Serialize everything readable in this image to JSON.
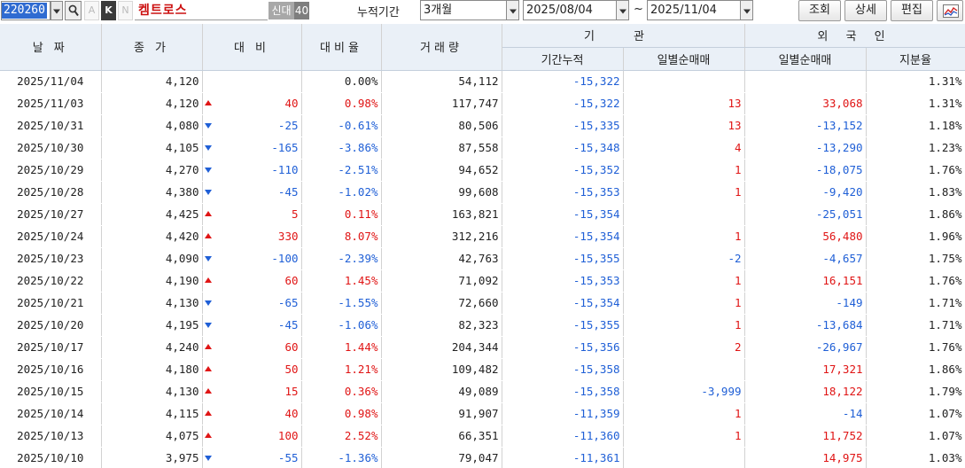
{
  "toolbar": {
    "stock_code": "220260",
    "btn_a": "A",
    "btn_k": "K",
    "btn_n": "N",
    "stock_name": "켐트로스",
    "badge_credit": "신대",
    "badge_margin": "40",
    "period_label": "누적기간",
    "period_value": "3개월",
    "start_date": "2025/08/04",
    "tilde": "~",
    "end_date": "2025/11/04",
    "btn_query": "조회",
    "btn_detail": "상세",
    "btn_edit": "편집"
  },
  "headers": {
    "date": "날 짜",
    "close": "종 가",
    "change": "대 비",
    "change_rate": "대비율",
    "volume": "거래량",
    "institution": "기 관",
    "inst_cum": "기간누적",
    "inst_daily": "일별순매매",
    "foreign": "외 국 인",
    "frn_daily": "일별순매매",
    "frn_ratio": "지분율"
  },
  "rows": [
    {
      "date": "2025/11/04",
      "close": "4,120",
      "dir": "flat",
      "change": "",
      "rate": "0.00%",
      "volume": "54,112",
      "inst_cum": "-15,322",
      "inst_daily": "",
      "frn_daily": "",
      "frn_ratio": "1.31%"
    },
    {
      "date": "2025/11/03",
      "close": "4,120",
      "dir": "up",
      "change": "40",
      "rate": "0.98%",
      "volume": "117,747",
      "inst_cum": "-15,322",
      "inst_daily": "13",
      "frn_daily": "33,068",
      "frn_ratio": "1.31%"
    },
    {
      "date": "2025/10/31",
      "close": "4,080",
      "dir": "down",
      "change": "-25",
      "rate": "-0.61%",
      "volume": "80,506",
      "inst_cum": "-15,335",
      "inst_daily": "13",
      "frn_daily": "-13,152",
      "frn_ratio": "1.18%"
    },
    {
      "date": "2025/10/30",
      "close": "4,105",
      "dir": "down",
      "change": "-165",
      "rate": "-3.86%",
      "volume": "87,558",
      "inst_cum": "-15,348",
      "inst_daily": "4",
      "frn_daily": "-13,290",
      "frn_ratio": "1.23%"
    },
    {
      "date": "2025/10/29",
      "close": "4,270",
      "dir": "down",
      "change": "-110",
      "rate": "-2.51%",
      "volume": "94,652",
      "inst_cum": "-15,352",
      "inst_daily": "1",
      "frn_daily": "-18,075",
      "frn_ratio": "1.76%"
    },
    {
      "date": "2025/10/28",
      "close": "4,380",
      "dir": "down",
      "change": "-45",
      "rate": "-1.02%",
      "volume": "99,608",
      "inst_cum": "-15,353",
      "inst_daily": "1",
      "frn_daily": "-9,420",
      "frn_ratio": "1.83%"
    },
    {
      "date": "2025/10/27",
      "close": "4,425",
      "dir": "up",
      "change": "5",
      "rate": "0.11%",
      "volume": "163,821",
      "inst_cum": "-15,354",
      "inst_daily": "",
      "frn_daily": "-25,051",
      "frn_ratio": "1.86%"
    },
    {
      "date": "2025/10/24",
      "close": "4,420",
      "dir": "up",
      "change": "330",
      "rate": "8.07%",
      "volume": "312,216",
      "inst_cum": "-15,354",
      "inst_daily": "1",
      "frn_daily": "56,480",
      "frn_ratio": "1.96%"
    },
    {
      "date": "2025/10/23",
      "close": "4,090",
      "dir": "down",
      "change": "-100",
      "rate": "-2.39%",
      "volume": "42,763",
      "inst_cum": "-15,355",
      "inst_daily": "-2",
      "frn_daily": "-4,657",
      "frn_ratio": "1.75%"
    },
    {
      "date": "2025/10/22",
      "close": "4,190",
      "dir": "up",
      "change": "60",
      "rate": "1.45%",
      "volume": "71,092",
      "inst_cum": "-15,353",
      "inst_daily": "1",
      "frn_daily": "16,151",
      "frn_ratio": "1.76%"
    },
    {
      "date": "2025/10/21",
      "close": "4,130",
      "dir": "down",
      "change": "-65",
      "rate": "-1.55%",
      "volume": "72,660",
      "inst_cum": "-15,354",
      "inst_daily": "1",
      "frn_daily": "-149",
      "frn_ratio": "1.71%"
    },
    {
      "date": "2025/10/20",
      "close": "4,195",
      "dir": "down",
      "change": "-45",
      "rate": "-1.06%",
      "volume": "82,323",
      "inst_cum": "-15,355",
      "inst_daily": "1",
      "frn_daily": "-13,684",
      "frn_ratio": "1.71%"
    },
    {
      "date": "2025/10/17",
      "close": "4,240",
      "dir": "up",
      "change": "60",
      "rate": "1.44%",
      "volume": "204,344",
      "inst_cum": "-15,356",
      "inst_daily": "2",
      "frn_daily": "-26,967",
      "frn_ratio": "1.76%"
    },
    {
      "date": "2025/10/16",
      "close": "4,180",
      "dir": "up",
      "change": "50",
      "rate": "1.21%",
      "volume": "109,482",
      "inst_cum": "-15,358",
      "inst_daily": "",
      "frn_daily": "17,321",
      "frn_ratio": "1.86%"
    },
    {
      "date": "2025/10/15",
      "close": "4,130",
      "dir": "up",
      "change": "15",
      "rate": "0.36%",
      "volume": "49,089",
      "inst_cum": "-15,358",
      "inst_daily": "-3,999",
      "frn_daily": "18,122",
      "frn_ratio": "1.79%"
    },
    {
      "date": "2025/10/14",
      "close": "4,115",
      "dir": "up",
      "change": "40",
      "rate": "0.98%",
      "volume": "91,907",
      "inst_cum": "-11,359",
      "inst_daily": "1",
      "frn_daily": "-14",
      "frn_ratio": "1.07%"
    },
    {
      "date": "2025/10/13",
      "close": "4,075",
      "dir": "up",
      "change": "100",
      "rate": "2.52%",
      "volume": "66,351",
      "inst_cum": "-11,360",
      "inst_daily": "1",
      "frn_daily": "11,752",
      "frn_ratio": "1.07%"
    },
    {
      "date": "2025/10/10",
      "close": "3,975",
      "dir": "down",
      "change": "-55",
      "rate": "-1.36%",
      "volume": "79,047",
      "inst_cum": "-11,361",
      "inst_daily": "",
      "frn_daily": "14,975",
      "frn_ratio": "1.03%"
    }
  ],
  "colors": {
    "up": "#e01515",
    "down": "#1f5fd6",
    "header_bg": "#eaf0f7",
    "code_highlight": "#2f6bd1"
  },
  "icons": {
    "search": "magnifier-icon",
    "chart": "line-chart-icon",
    "up": "triangle-up-icon",
    "down": "triangle-down-icon"
  }
}
